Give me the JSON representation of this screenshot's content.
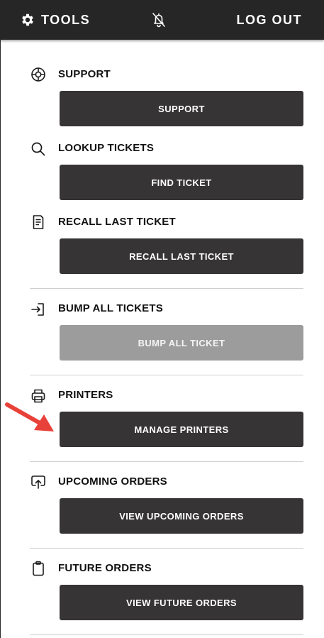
{
  "header": {
    "title": "TOOLS",
    "logout_label": "LOG OUT",
    "tools_icon": "gear-icon",
    "notification_icon": "bell-off-icon"
  },
  "sections": [
    {
      "heading": "SUPPORT",
      "icon": "lifebuoy-icon",
      "button": "SUPPORT",
      "disabled": false
    },
    {
      "heading": "LOOKUP TICKETS",
      "icon": "search-icon",
      "button": "FIND TICKET",
      "disabled": false
    },
    {
      "heading": "RECALL LAST TICKET",
      "icon": "document-icon",
      "button": "RECALL LAST TICKET",
      "disabled": false
    },
    {
      "heading": "BUMP ALL TICKETS",
      "icon": "sign-in-icon",
      "button": "BUMP ALL TICKET",
      "disabled": true
    },
    {
      "heading": "PRINTERS",
      "icon": "printer-icon",
      "button": "MANAGE PRINTERS",
      "disabled": false
    },
    {
      "heading": "UPCOMING ORDERS",
      "icon": "upload-icon",
      "button": "VIEW UPCOMING ORDERS",
      "disabled": false
    },
    {
      "heading": "FUTURE ORDERS",
      "icon": "clipboard-icon",
      "button": "VIEW FUTURE ORDERS",
      "disabled": false
    }
  ],
  "colors": {
    "header_bg": "#262626",
    "button_bg": "#363435",
    "button_disabled_bg": "#9c9c9c",
    "annotation_arrow": "#e8413a"
  }
}
